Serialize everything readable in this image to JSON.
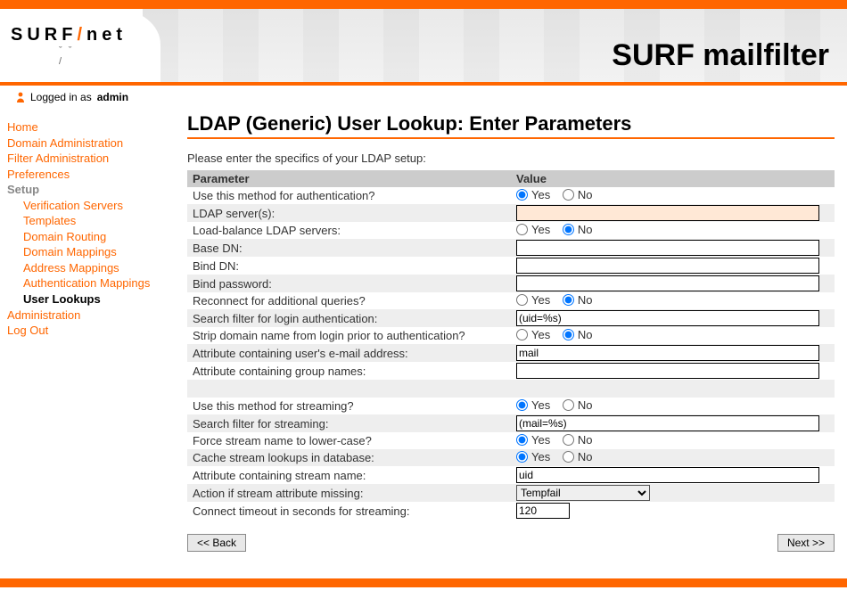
{
  "app": {
    "title": "SURF mailfilter",
    "logo_main": "SURF",
    "logo_net": "net",
    "logo_slash": "/"
  },
  "login": {
    "prefix": "Logged in as ",
    "user": "admin"
  },
  "sidebar": {
    "home": "Home",
    "domain_admin": "Domain Administration",
    "filter_admin": "Filter Administration",
    "preferences": "Preferences",
    "setup": "Setup",
    "sub": {
      "verification_servers": "Verification Servers",
      "templates": "Templates",
      "domain_routing": "Domain Routing",
      "domain_mappings": "Domain Mappings",
      "address_mappings": "Address Mappings",
      "auth_mappings": "Authentication Mappings",
      "user_lookups": "User Lookups"
    },
    "administration": "Administration",
    "logout": "Log Out"
  },
  "page": {
    "title": "LDAP (Generic) User Lookup: Enter Parameters",
    "intro": "Please enter the specifics of your LDAP setup:"
  },
  "table": {
    "header_param": "Parameter",
    "header_value": "Value"
  },
  "labels": {
    "yes": "Yes",
    "no": "No"
  },
  "params": {
    "use_auth": "Use this method for authentication?",
    "ldap_servers": "LDAP server(s):",
    "load_balance": "Load-balance LDAP servers:",
    "base_dn": "Base DN:",
    "bind_dn": "Bind DN:",
    "bind_pw": "Bind password:",
    "reconnect": "Reconnect for additional queries?",
    "search_login": "Search filter for login authentication:",
    "strip_domain": "Strip domain name from login prior to authentication?",
    "attr_email": "Attribute containing user's e-mail address:",
    "attr_group": "Attribute containing group names:",
    "use_streaming": "Use this method for streaming?",
    "search_stream": "Search filter for streaming:",
    "force_lower": "Force stream name to lower-case?",
    "cache_lookups": "Cache stream lookups in database:",
    "attr_stream": "Attribute containing stream name:",
    "action_missing": "Action if stream attribute missing:",
    "connect_timeout": "Connect timeout in seconds for streaming:"
  },
  "values": {
    "use_auth": "Yes",
    "ldap_servers": "",
    "load_balance": "No",
    "base_dn": "",
    "bind_dn": "",
    "bind_pw": "",
    "reconnect": "No",
    "search_login": "(uid=%s)",
    "strip_domain": "No",
    "attr_email": "mail",
    "attr_group": "",
    "use_streaming": "Yes",
    "search_stream": "(mail=%s)",
    "force_lower": "Yes",
    "cache_lookups": "Yes",
    "attr_stream": "uid",
    "action_missing": "Tempfail",
    "connect_timeout": "120"
  },
  "select_options": {
    "action_missing": [
      "Tempfail"
    ]
  },
  "buttons": {
    "back": "<< Back",
    "next": "Next >>"
  }
}
